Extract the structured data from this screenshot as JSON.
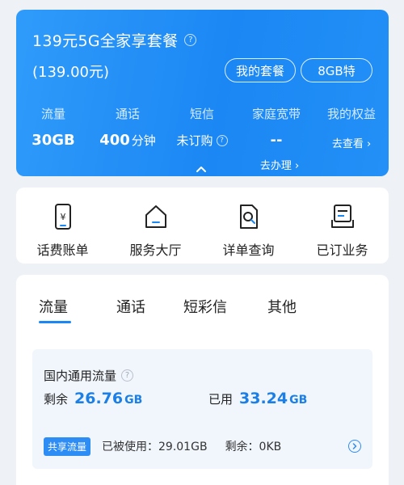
{
  "plan": {
    "title": "139元5G全家享套餐",
    "price": "(139.00元)",
    "my_plan_label": "我的套餐",
    "pack_label": "8GB特",
    "help_icon": "question-circle-icon",
    "stats": [
      {
        "label": "流量",
        "value": "30GB",
        "unit": ""
      },
      {
        "label": "通话",
        "value": "400",
        "unit": "分钟"
      },
      {
        "label": "短信",
        "value": "未订购",
        "unit": ""
      },
      {
        "label": "家庭宽带",
        "value": "--",
        "unit": ""
      },
      {
        "label": "我的权益",
        "value": "去查看 ›",
        "unit": ""
      }
    ],
    "broadband_action": "去办理 ›",
    "gradient_start": "#2f9bfa",
    "gradient_end": "#1b87f4"
  },
  "shortcuts": [
    {
      "label": "话费账单",
      "icon": "phone-bill-icon"
    },
    {
      "label": "服务大厅",
      "icon": "service-hall-icon"
    },
    {
      "label": "详单查询",
      "icon": "detail-query-icon"
    },
    {
      "label": "已订业务",
      "icon": "subscribed-services-icon"
    }
  ],
  "usage": {
    "tabs": [
      "流量",
      "通话",
      "短彩信",
      "其他"
    ],
    "active_tab": "流量",
    "flow_title": "国内通用流量",
    "remain_label": "剩余",
    "remain_value": "26.76",
    "remain_unit": "GB",
    "used_label": "已用",
    "used_value": "33.24",
    "used_unit": "GB",
    "share_badge": "共享流量",
    "share_used": "已被使用：29.01GB",
    "share_left": "剩余：0KB",
    "accent": "#1b87f4"
  }
}
